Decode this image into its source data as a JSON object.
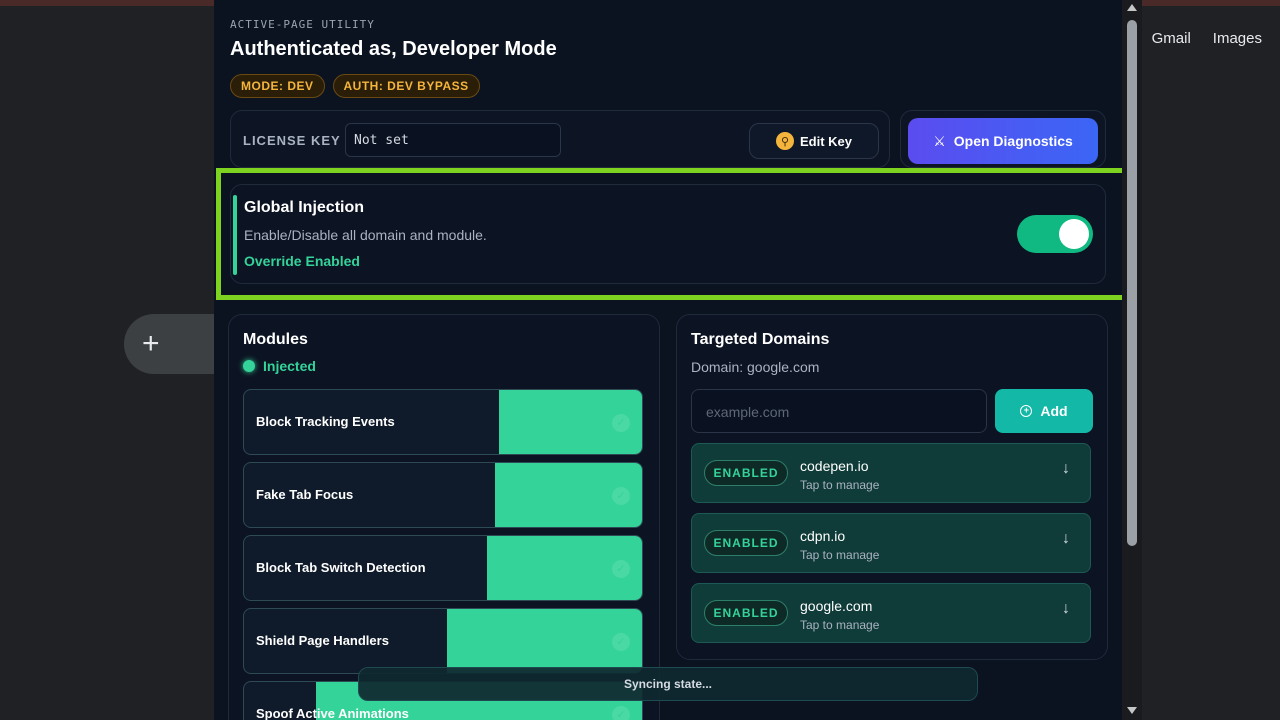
{
  "browser": {
    "links": [
      "Gmail",
      "Images"
    ],
    "new_shortcut_label": "+"
  },
  "header": {
    "overline": "ACTIVE-PAGE UTILITY",
    "title": "Authenticated as, Developer Mode",
    "badges": [
      "MODE: DEV",
      "AUTH: DEV BYPASS"
    ]
  },
  "license": {
    "label": "LICENSE KEY",
    "value": "Not set",
    "edit_label": "Edit Key",
    "diagnostics_label": "Open Diagnostics"
  },
  "injection": {
    "title": "Global Injection",
    "description": "Enable/Disable all domain and module.",
    "status": "Override Enabled",
    "enabled": true
  },
  "modules": {
    "title": "Modules",
    "status": "Injected",
    "items": [
      {
        "label": "Block Tracking Events",
        "fill": 0.36
      },
      {
        "label": "Fake Tab Focus",
        "fill": 0.37
      },
      {
        "label": "Block Tab Switch Detection",
        "fill": 0.39
      },
      {
        "label": "Shield Page Handlers",
        "fill": 0.49
      },
      {
        "label": "Spoof Active Animations",
        "fill": 0.82
      }
    ]
  },
  "domains": {
    "title": "Targeted Domains",
    "subtitle": "Domain: google.com",
    "input_placeholder": "example.com",
    "add_label": "Add",
    "items": [
      {
        "badge": "ENABLED",
        "name": "codepen.io",
        "sub": "Tap to manage"
      },
      {
        "badge": "ENABLED",
        "name": "cdpn.io",
        "sub": "Tap to manage"
      },
      {
        "badge": "ENABLED",
        "name": "google.com",
        "sub": "Tap to manage"
      }
    ]
  },
  "toast": {
    "text": "Syncing state..."
  },
  "colors": {
    "accent_green": "#34d399",
    "highlight_frame": "#7ed321",
    "diagnostics_gradient": "#5b4cf0",
    "badge_amber": "#f5b53d"
  }
}
